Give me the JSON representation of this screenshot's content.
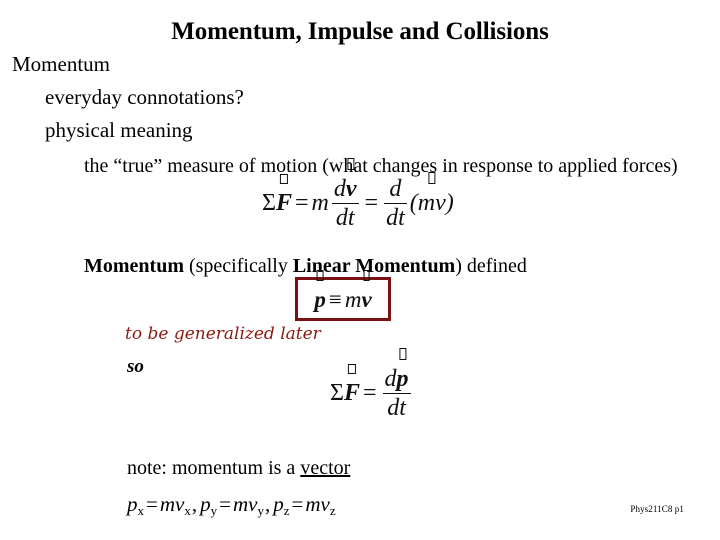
{
  "slide": {
    "title": "Momentum, Impulse and Collisions",
    "footer": "Phys211C8 p1",
    "colors": {
      "background": "#ffffff",
      "text": "#000000",
      "accent_red": "#7B1113",
      "note_red": "#8B1A11"
    }
  },
  "outline": {
    "level1_momentum": "Momentum",
    "level2_everyday": "everyday connotations?",
    "level2_physical": "physical meaning",
    "level3_true_measure": "the “true” measure of motion (what changes in response to applied forces)"
  },
  "definition_line": {
    "lead_bold": "Momentum",
    "middle": " (specifically ",
    "emphasis_bold": "Linear Momentum",
    "tail": ") defined"
  },
  "notes": {
    "generalized_later": "to be generalized later",
    "so": "so",
    "vector_note_prefix": "note: momentum is a ",
    "vector_note_underlined": "vector"
  },
  "equations": {
    "newton_second_law": {
      "id": "sum-F-equals-m-dv-dt",
      "text": "ΣF = m dv/dt = d/dt (mv)",
      "parts": {
        "sigma": "Σ",
        "force": "F",
        "equals": "=",
        "mass": "m",
        "d_num": "d",
        "v": "v",
        "dt": "dt",
        "d": "d",
        "open_paren": "(",
        "mv": "mv",
        "close_paren": ")"
      }
    },
    "momentum_definition": {
      "id": "p-equiv-mv",
      "text": "p ≡ mv",
      "boxed": true,
      "parts": {
        "p": "p",
        "equiv": "≡",
        "m": "m",
        "v": "v"
      }
    },
    "force_equals_dp_dt": {
      "id": "sum-F-equals-dp-dt",
      "text": "ΣF = dp/dt",
      "parts": {
        "sigma": "Σ",
        "force": "F",
        "equals": "=",
        "d": "d",
        "p": "p",
        "dt": "dt"
      }
    },
    "components": {
      "id": "momentum-components",
      "text": "p_x = mv_x , p_y = mv_y , p_z = mv_z",
      "terms": [
        {
          "lhs": "p",
          "lhs_sub": "x",
          "rhs": "mv",
          "rhs_sub": "x"
        },
        {
          "lhs": "p",
          "lhs_sub": "y",
          "rhs": "mv",
          "rhs_sub": "y"
        },
        {
          "lhs": "p",
          "lhs_sub": "z",
          "rhs": "mv",
          "rhs_sub": "z"
        }
      ],
      "equals": "=",
      "separator": ","
    }
  }
}
